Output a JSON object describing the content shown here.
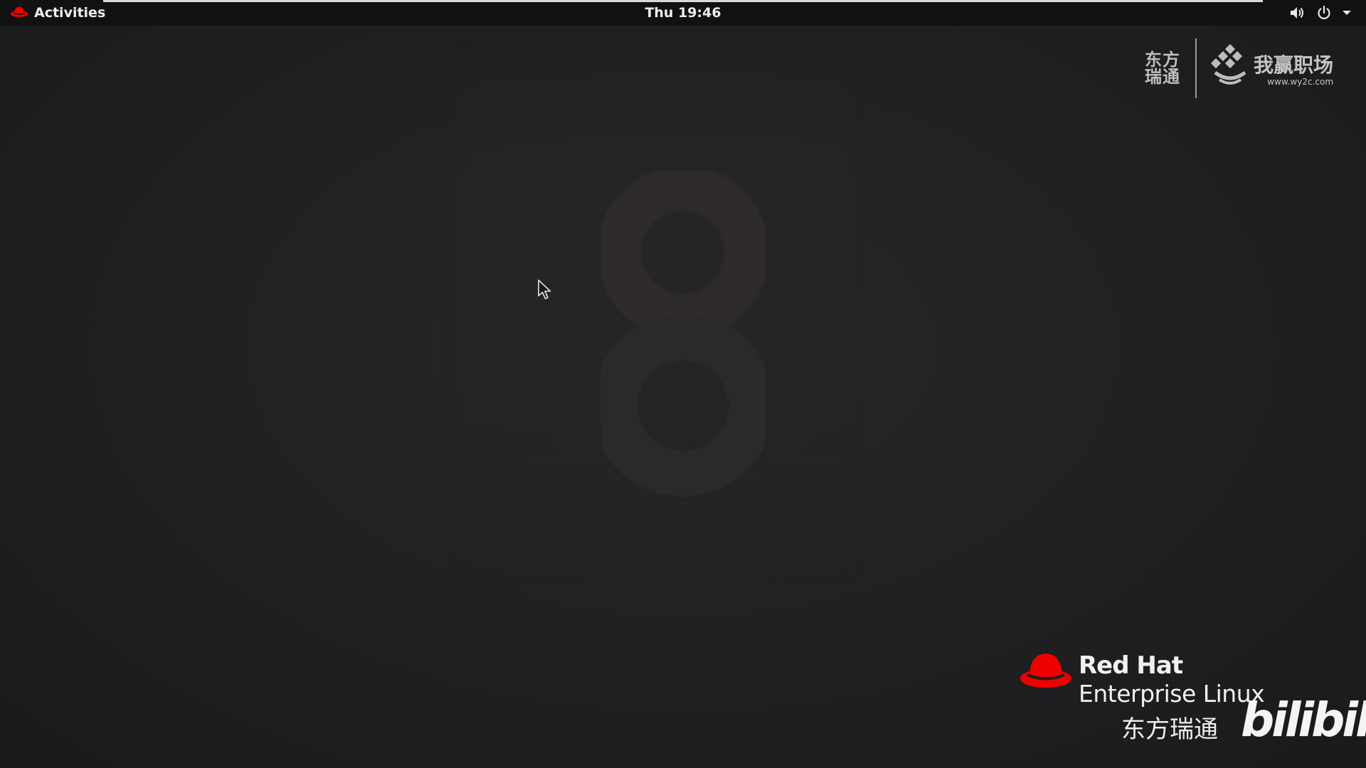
{
  "topbar": {
    "activities_label": "Activities",
    "clock": "Thu 19:46",
    "icons": [
      "redhat-hat-icon",
      "volume-icon",
      "power-icon",
      "chevron-down-icon"
    ]
  },
  "wallpaper": {
    "version_numeral": "8"
  },
  "watermark": {
    "dongfang_line1": "东方",
    "dongfang_line2": "瑞通",
    "wy_name": "我赢职场",
    "wy_url": "www.wy2c.com"
  },
  "branding": {
    "redhat": "Red Hat",
    "product": "Enterprise Linux",
    "chinese": "东方瑞通",
    "bilibili": "bilibili"
  },
  "colors": {
    "topbar_bg": "#111112",
    "desktop_bg": "#1f1f21",
    "redhat_red": "#ee0000",
    "text": "#eeeeee"
  }
}
